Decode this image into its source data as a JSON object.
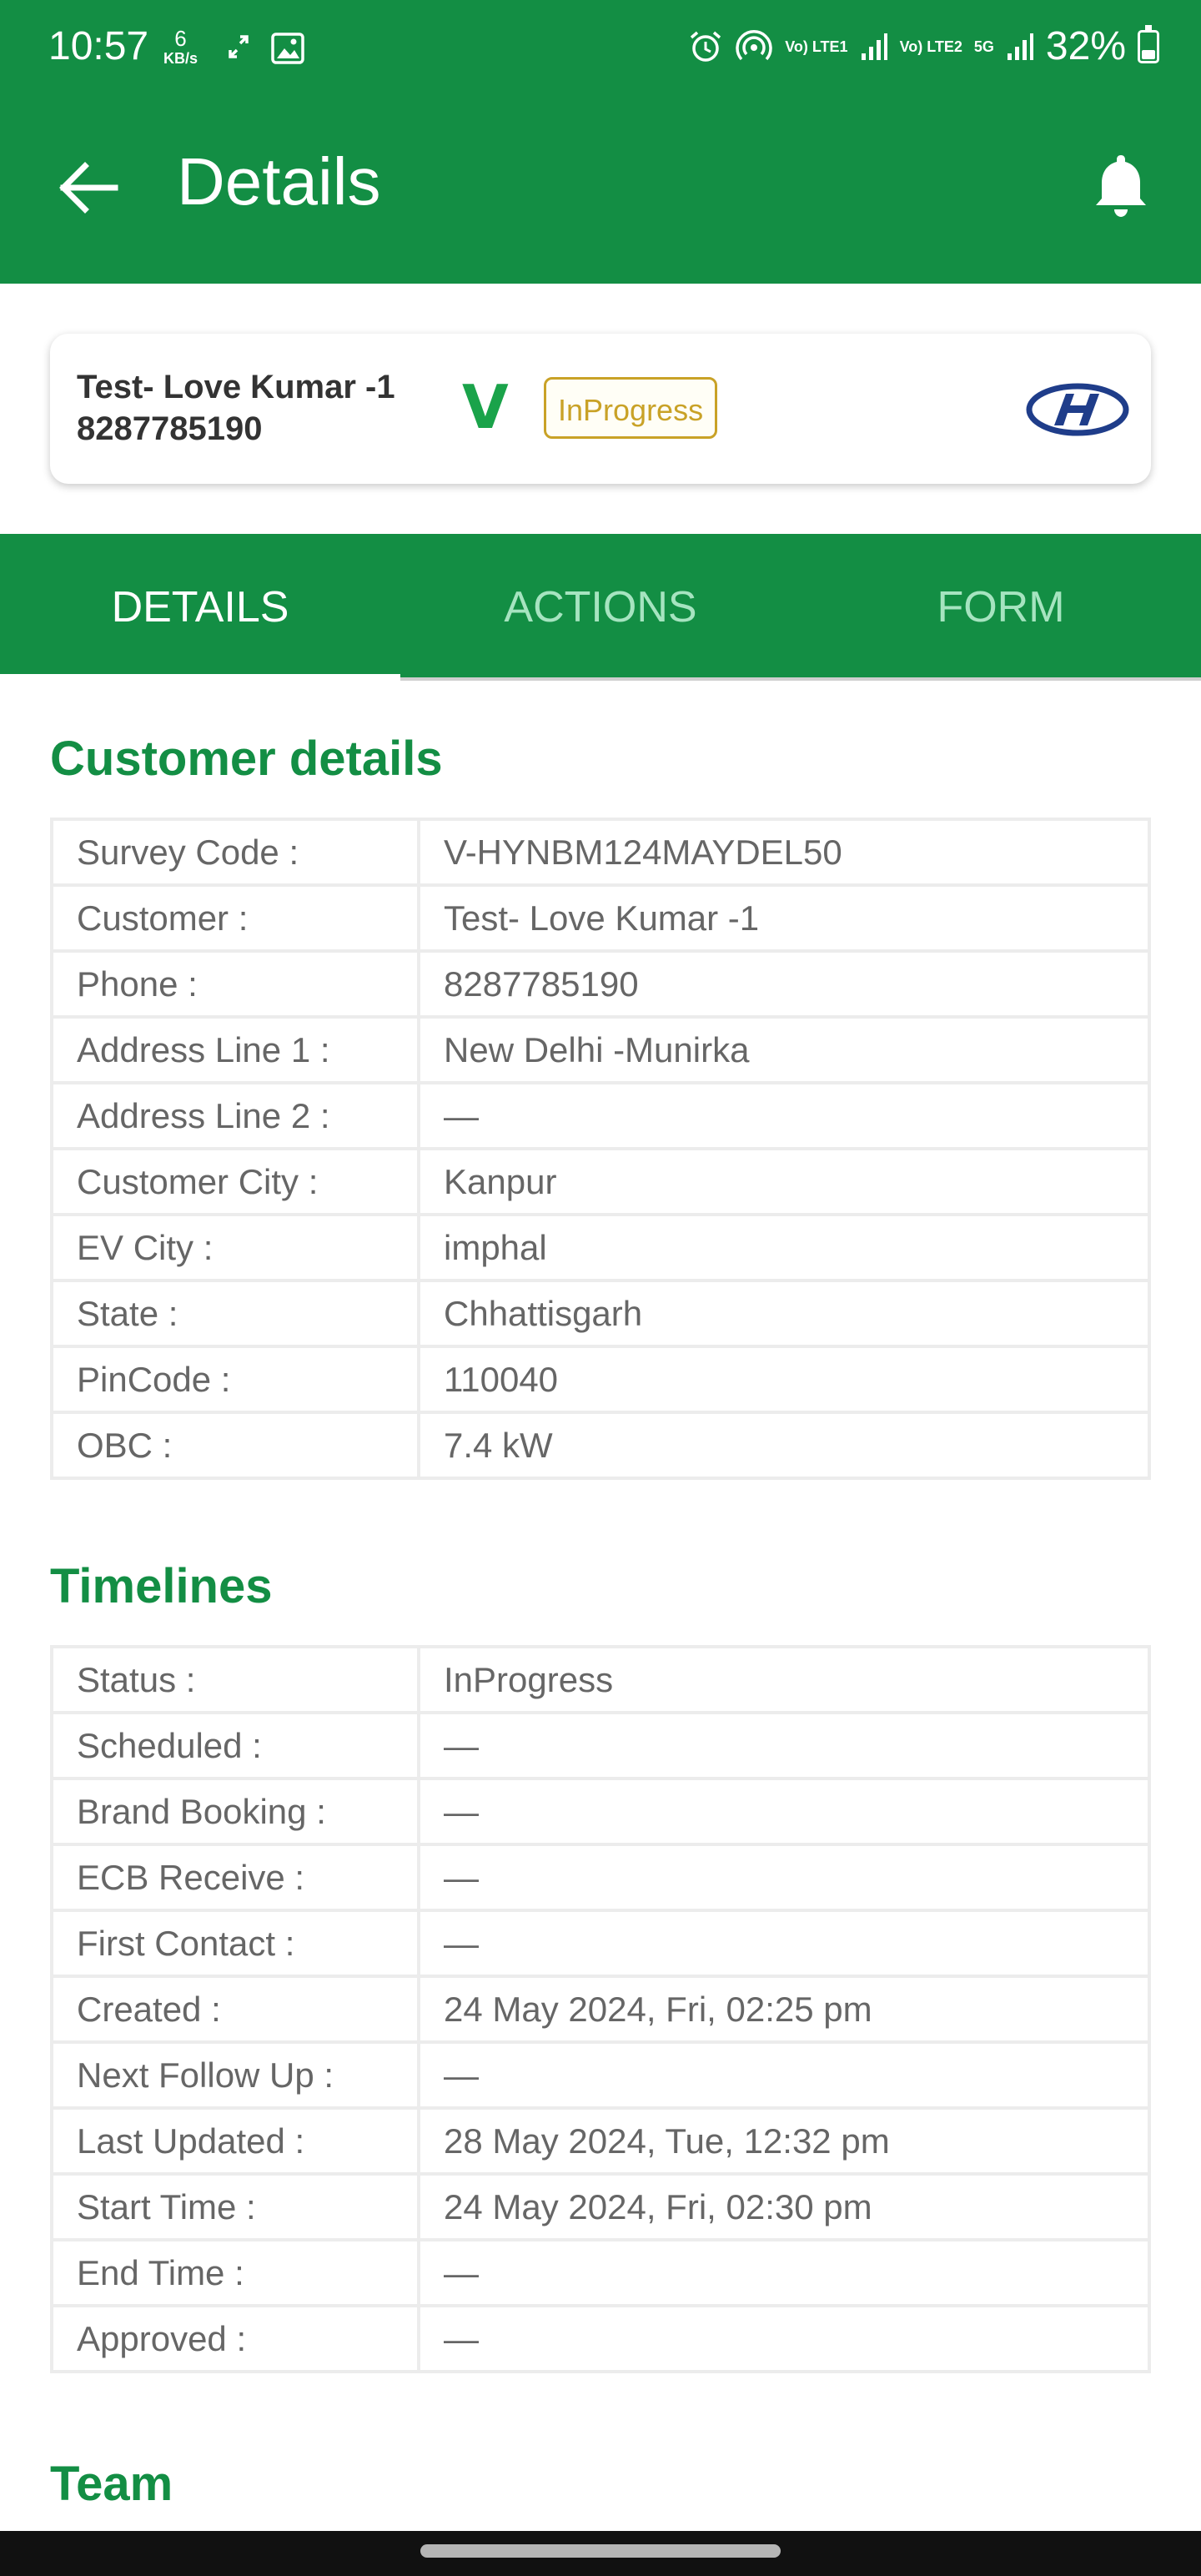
{
  "status_bar": {
    "time": "10:57",
    "net_speed": "6",
    "net_speed_unit": "KB/s",
    "sim1": "Vo) LTE1",
    "sim2": "Vo) LTE2",
    "network_5g": "5G",
    "battery": "32%",
    "battery_level": 0.32
  },
  "app_bar": {
    "title": "Details"
  },
  "summary_card": {
    "name": "Test- Love Kumar -1",
    "phone": "8287785190",
    "vendor_mark": "V",
    "status": "InProgress",
    "brand_icon": "hyundai-logo"
  },
  "tabs": [
    {
      "label": "DETAILS",
      "active": true
    },
    {
      "label": "ACTIONS",
      "active": false
    },
    {
      "label": "FORM",
      "active": false
    }
  ],
  "customer_details": {
    "title": "Customer details",
    "rows": [
      {
        "key": "Survey Code :",
        "value": "V-HYNBM124MAYDEL50"
      },
      {
        "key": "Customer :",
        "value": "Test- Love Kumar -1"
      },
      {
        "key": "Phone :",
        "value": "8287785190"
      },
      {
        "key": "Address Line 1 :",
        "value": "New Delhi -Munirka"
      },
      {
        "key": "Address Line 2 :",
        "value": "—"
      },
      {
        "key": "Customer City :",
        "value": "Kanpur"
      },
      {
        "key": "EV City :",
        "value": "imphal"
      },
      {
        "key": "State :",
        "value": "Chhattisgarh"
      },
      {
        "key": "PinCode :",
        "value": "110040"
      },
      {
        "key": "OBC :",
        "value": "7.4 kW"
      }
    ]
  },
  "timelines": {
    "title": "Timelines",
    "rows": [
      {
        "key": "Status :",
        "value": "InProgress"
      },
      {
        "key": "Scheduled :",
        "value": "—"
      },
      {
        "key": "Brand Booking :",
        "value": "—"
      },
      {
        "key": "ECB Receive :",
        "value": "—"
      },
      {
        "key": "First Contact :",
        "value": "—"
      },
      {
        "key": "Created :",
        "value": "24 May 2024, Fri, 02:25 pm"
      },
      {
        "key": "Next Follow Up :",
        "value": "—"
      },
      {
        "key": "Last Updated :",
        "value": "28 May 2024, Tue, 12:32 pm"
      },
      {
        "key": "Start Time :",
        "value": "24 May 2024, Fri, 02:30 pm"
      },
      {
        "key": "End Time :",
        "value": "—"
      },
      {
        "key": "Approved :",
        "value": "—"
      }
    ]
  },
  "team": {
    "title": "Team"
  },
  "colors": {
    "primary_green": "#138e44",
    "status_gold": "#c9a227"
  }
}
